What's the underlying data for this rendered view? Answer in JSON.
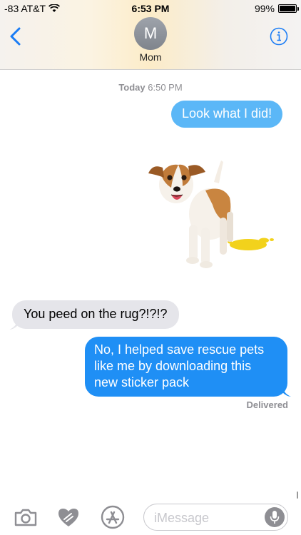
{
  "status_bar": {
    "carrier": "-83 AT&T",
    "time": "6:53 PM",
    "battery": "99%"
  },
  "header": {
    "avatar_initial": "M",
    "contact_name": "Mom"
  },
  "conversation": {
    "timestamp_day": "Today",
    "timestamp_time": "6:50 PM",
    "messages": [
      {
        "direction": "outgoing",
        "text": "Look what I did!"
      },
      {
        "direction": "incoming",
        "text": "You peed on the rug?!?!?"
      },
      {
        "direction": "outgoing",
        "text": "No, I helped save rescue pets like me by downloading this new sticker pack"
      }
    ],
    "delivery_status": "Delivered"
  },
  "composer": {
    "placeholder": "iMessage",
    "icons": [
      "camera-icon",
      "digital-touch-icon",
      "app-store-icon",
      "microphone-icon"
    ]
  },
  "colors": {
    "accent": "#1a7cf5",
    "outgoing_bubble": "#1f8ff5",
    "incoming_bubble": "#e5e5ea"
  }
}
